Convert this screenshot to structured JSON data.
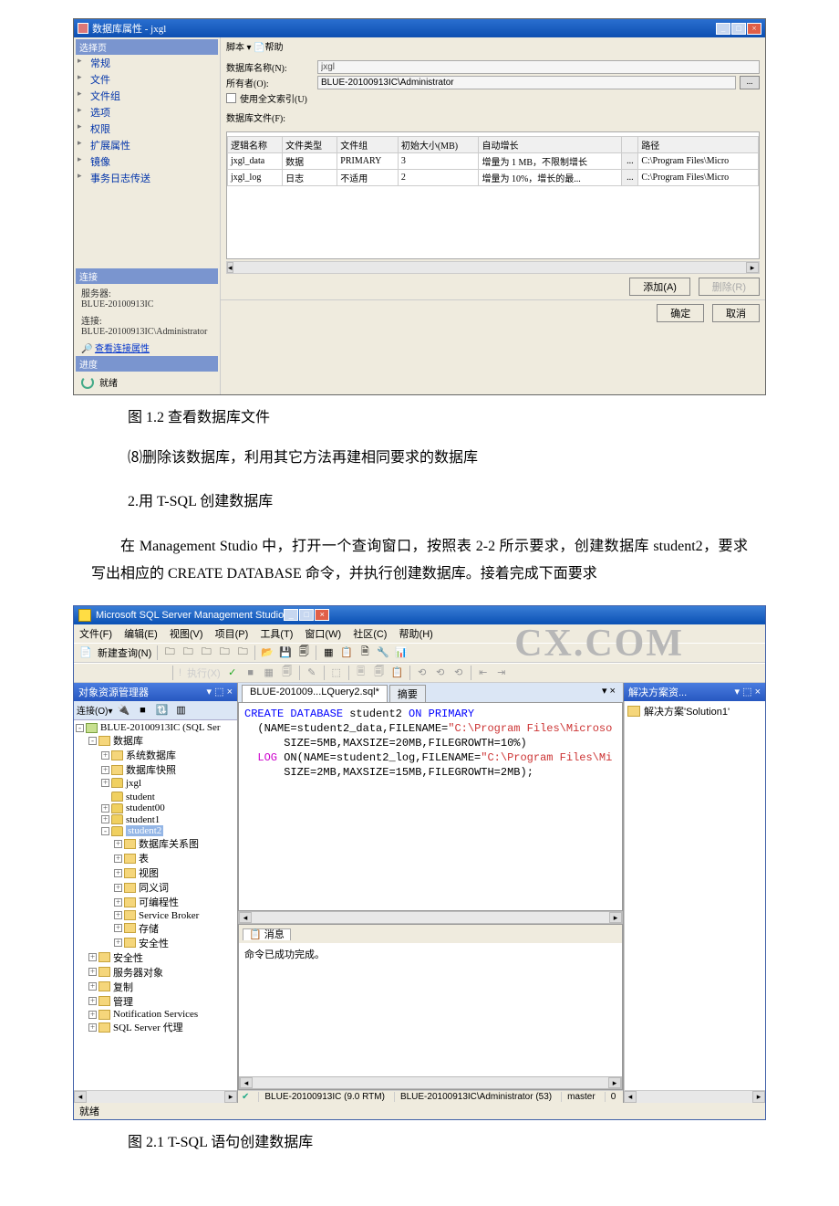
{
  "shot1": {
    "title": "数据库属性 - jxgl",
    "nav_header": "选择页",
    "nav": [
      "常规",
      "文件",
      "文件组",
      "选项",
      "权限",
      "扩展属性",
      "镜像",
      "事务日志传送"
    ],
    "conn_header": "连接",
    "server_lbl": "服务器:",
    "server_val": "BLUE-20100913IC",
    "conn_lbl": "连接:",
    "conn_val": "BLUE-20100913IC\\Administrator",
    "conn_link": "查看连接属性",
    "prog_header": "进度",
    "ready": "就绪",
    "toolbar": "脚本 ▾  📄帮助",
    "dbname_lbl": "数据库名称(N):",
    "dbname_val": "jxgl",
    "owner_lbl": "所有者(O):",
    "owner_val": "BLUE-20100913IC\\Administrator",
    "fulltext": "使用全文索引(U)",
    "files_lbl": "数据库文件(F):",
    "cols": [
      "逻辑名称",
      "文件类型",
      "文件组",
      "初始大小(MB)",
      "自动增长",
      "路径"
    ],
    "rows": [
      [
        "jxgl_data",
        "数据",
        "PRIMARY",
        "3",
        "增量为 1 MB，不限制增长",
        "...",
        "C:\\Program Files\\Micro"
      ],
      [
        "jxgl_log",
        "日志",
        "不适用",
        "2",
        "增量为 10%，增长的最...",
        "...",
        "C:\\Program Files\\Micro"
      ]
    ],
    "add": "添加(A)",
    "del": "删除(R)",
    "ok": "确定",
    "cancel": "取消"
  },
  "cap1": "图 1.2 查看数据库文件",
  "p8": "⑻删除该数据库，利用其它方法再建相同要求的数据库",
  "p9": "2.用 T-SQL 创建数据库",
  "p10": "在 Management Studio 中，打开一个查询窗口，按照表 2-2 所示要求，创建数据库 student2，要求写出相应的 CREATE DATABASE 命令，并执行创建数据库。接着完成下面要求",
  "ssms": {
    "title": "Microsoft SQL Server Management Studio",
    "watermark": "CX.COM",
    "menus": [
      "文件(F)",
      "编辑(E)",
      "视图(V)",
      "项目(P)",
      "工具(T)",
      "窗口(W)",
      "社区(C)",
      "帮助(H)"
    ],
    "newquery": "新建查询(N)",
    "exec": "执行(X)",
    "obj_title": "对象资源管理器",
    "obj_conn": "连接(O)▾",
    "tree": {
      "root": "BLUE-20100913IC (SQL Ser",
      "dbs": "数据库",
      "sysdb": "系统数据库",
      "snap": "数据库快照",
      "n1": "jxgl",
      "n2": "student",
      "n3": "student00",
      "n4": "student1",
      "n5": "student2",
      "s1": "数据库关系图",
      "s2": "表",
      "s3": "视图",
      "s4": "同义词",
      "s5": "可编程性",
      "s6": "Service Broker",
      "s7": "存储",
      "s8": "安全性",
      "sec": "安全性",
      "svrobj": "服务器对象",
      "repl": "复制",
      "mgmt": "管理",
      "notif": "Notification Services",
      "agent": "SQL Server 代理"
    },
    "tab1": "BLUE-201009...LQuery2.sql*",
    "tab2": "摘要",
    "sql": {
      "l1a": "CREATE",
      "l1b": "DATABASE",
      "l1c": "student2",
      "l1d": "ON",
      "l1e": "PRIMARY",
      "l2a": "(NAME=",
      "l2b": "student2_data",
      "l2c": ",FILENAME=",
      "l2d": "\"C:\\Program Files\\Microso",
      "l3a": "SIZE=",
      "l3b": "5MB",
      "l3c": ",MAXSIZE=",
      "l3d": "20MB",
      "l3e": ",FILEGROWTH=",
      "l3f": "10%)",
      "l4a": "LOG",
      "l4b": "ON(NAME=",
      "l4c": "student2_log",
      "l4d": ",FILENAME=",
      "l4e": "\"C:\\Program Files\\Mi",
      "l5a": "SIZE=",
      "l5b": "2MB",
      "l5c": ",MAXSIZE=",
      "l5d": "15MB",
      "l5e": ",FILEGROWTH=",
      "l5f": "2MB);"
    },
    "msg_tab": "消息",
    "msg_body": "命令已成功完成。",
    "sol_title": "解决方案资...",
    "sol_item": "解决方案'Solution1'",
    "status_server": "BLUE-20100913IC (9.0 RTM)",
    "status_user": "BLUE-20100913IC\\Administrator (53)",
    "status_db": "master",
    "status_rows": "0",
    "statusbar": "就绪"
  },
  "cap2": "图 2.1 T-SQL 语句创建数据库"
}
